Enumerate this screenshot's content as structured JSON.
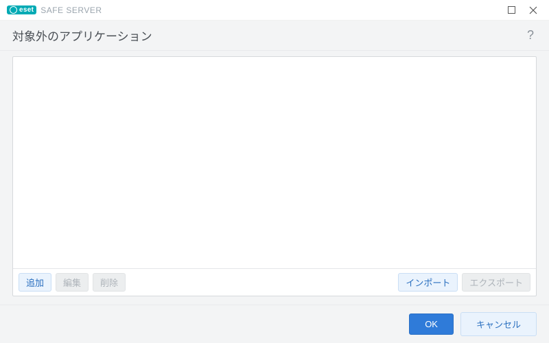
{
  "titlebar": {
    "brand_logo_text": "eset",
    "brand_name": "SAFE SERVER"
  },
  "header": {
    "title": "対象外のアプリケーション",
    "help_symbol": "?"
  },
  "toolbar": {
    "add": "追加",
    "edit": "編集",
    "delete": "削除",
    "import": "インポート",
    "export": "エクスポート"
  },
  "footer": {
    "ok": "OK",
    "cancel": "キャンセル"
  }
}
